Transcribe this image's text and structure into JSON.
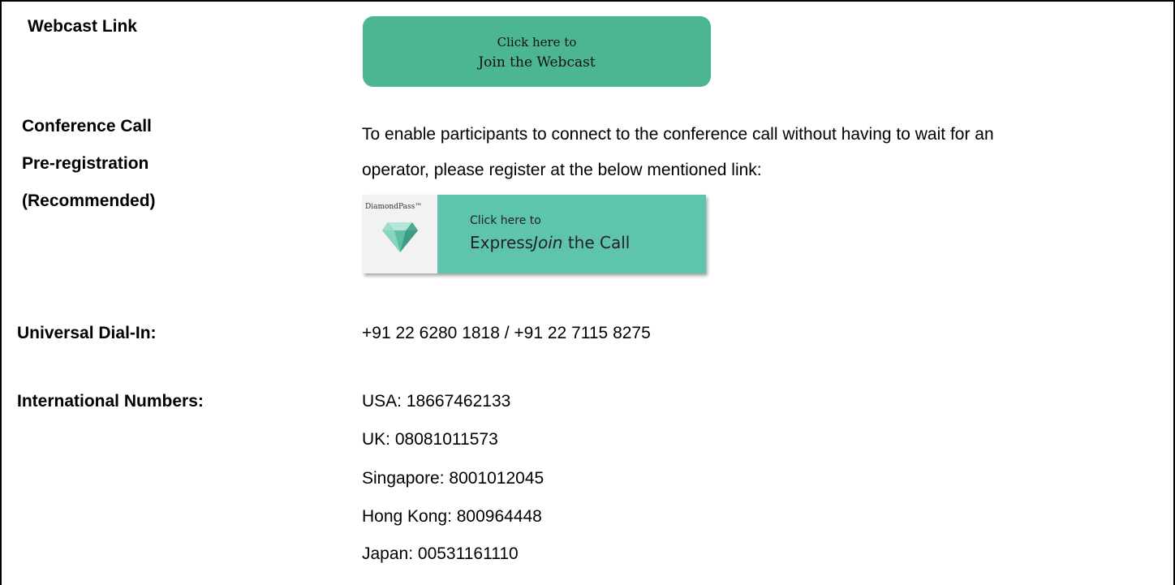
{
  "webcast": {
    "label": "Webcast Link",
    "button_line1": "Click here to",
    "button_line2": "Join the Webcast",
    "button_color": "#4cb593"
  },
  "conference": {
    "label_line1": "Conference Call",
    "label_line2": "Pre-registration",
    "label_line3": "(Recommended)",
    "description_line1": "To enable participants to connect to the conference call without having to wait for an",
    "description_line2": "operator, please register at the below mentioned link:",
    "diamondpass": {
      "brand_text": "DiamondPass™",
      "icon": "diamond-icon",
      "line1": "Click here to",
      "line2_prefix": "Express",
      "line2_italic": "Join",
      "line2_suffix": " the Call",
      "accent_color": "#5ec4ab"
    }
  },
  "dial_in": {
    "label": "Universal Dial-In:",
    "value": "+91 22 6280 1818 / +91 22 7115 8275"
  },
  "international": {
    "label": "International Numbers:",
    "numbers": [
      "USA: 18667462133",
      "UK: 08081011573",
      "Singapore: 8001012045",
      "Hong Kong: 800964448",
      "Japan: 00531161110"
    ]
  }
}
